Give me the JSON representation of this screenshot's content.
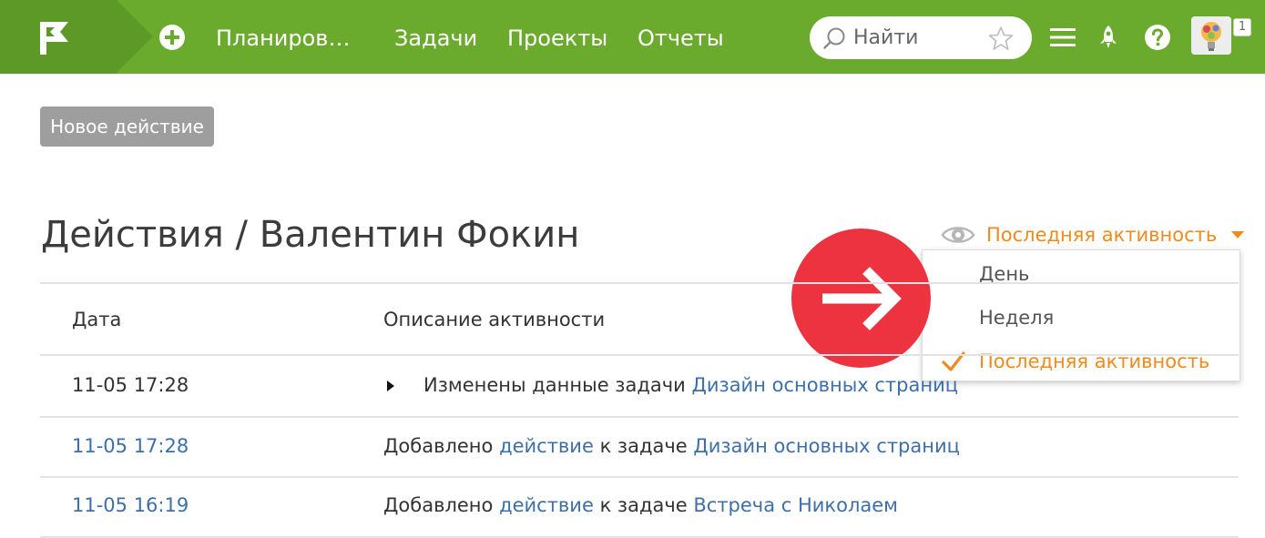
{
  "header": {
    "nav": [
      "Планиров…",
      "Задачи",
      "Проекты",
      "Отчеты"
    ],
    "search_placeholder": "Найти",
    "notifications_count": "1",
    "accent_color": "#6aaa2c"
  },
  "toolbar": {
    "new_action_label": "Новое действие"
  },
  "page": {
    "title": "Действия / Валентин Фокин"
  },
  "filter": {
    "current": "Последняя активность",
    "options": [
      "День",
      "Неделя",
      "Последняя активность"
    ],
    "accent_color": "#f08a1c"
  },
  "table": {
    "headers": [
      "Дата",
      "Описание активности"
    ],
    "rows": [
      {
        "date": "11-05 17:28",
        "text": "Изменены данные задачи",
        "target": "Дизайн основных страниц"
      },
      {
        "date": "11-05 17:28",
        "text": "Добавлено",
        "action_link": "действие",
        "middle": "к задаче",
        "target": "Дизайн основных страниц"
      },
      {
        "date": "11-05 16:19",
        "text": "Добавлено",
        "action_link": "действие",
        "middle": "к задаче",
        "target": "Встреча с Николаем"
      }
    ]
  }
}
